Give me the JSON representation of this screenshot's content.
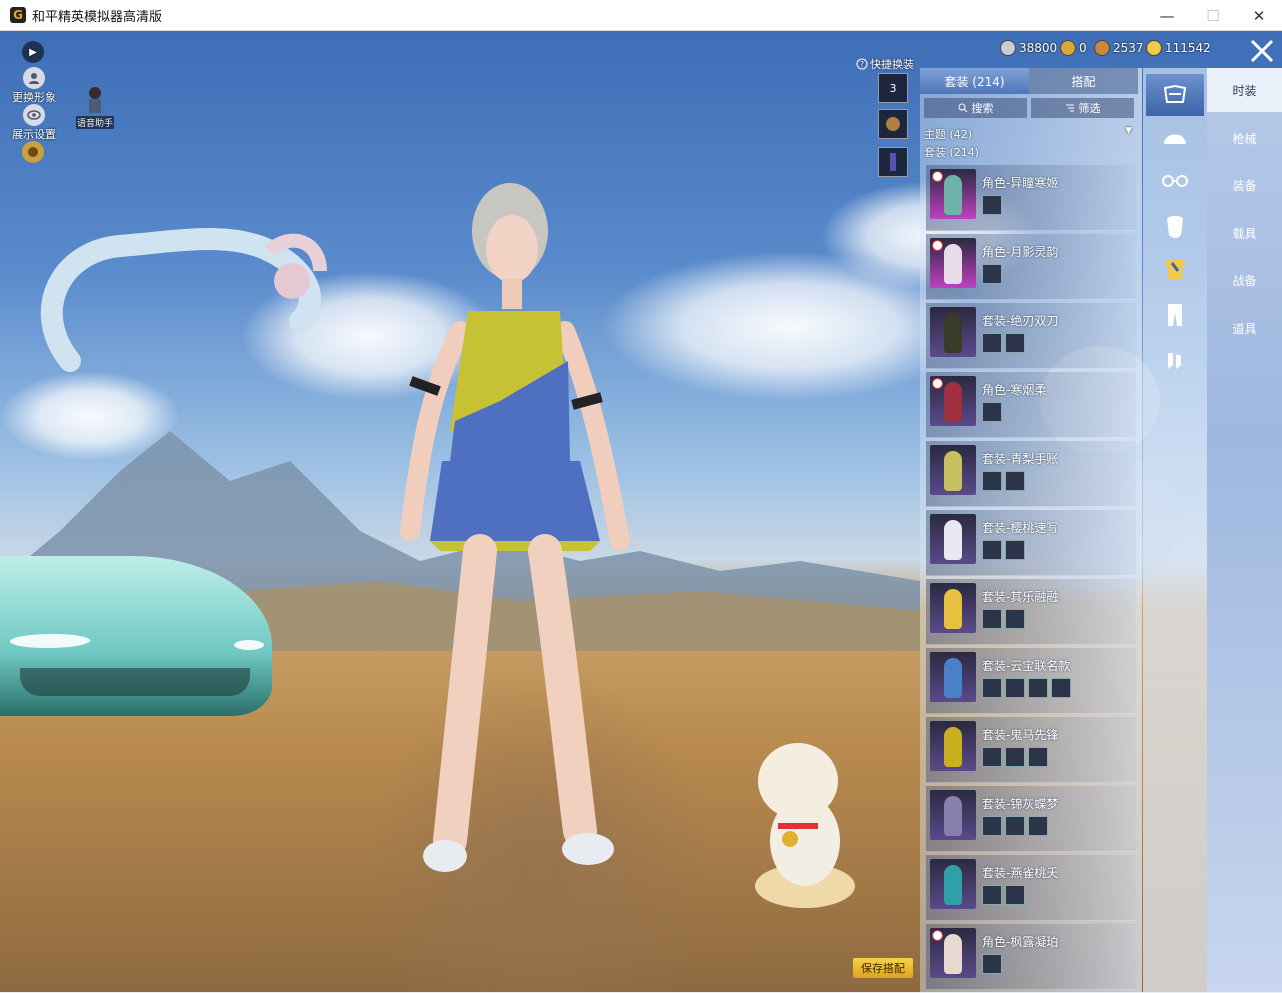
{
  "window": {
    "title": "和平精英模拟器高清版",
    "minimize": "—",
    "maximize": "☐",
    "close": "✕"
  },
  "left_tools": {
    "toggle_icon": "▶",
    "change_avatar": "更换形象",
    "display_settings": "展示设置",
    "assistant": "语音助手"
  },
  "currency": [
    {
      "name": "silver",
      "value": "38800",
      "color": "#c8ccd4"
    },
    {
      "name": "medal",
      "value": "0",
      "color": "#d9a63a"
    },
    {
      "name": "bronze",
      "value": "2537",
      "color": "#c88a3a"
    },
    {
      "name": "gold",
      "value": "111542",
      "color": "#f2c94c"
    }
  ],
  "quick_swap": {
    "label": "快捷换装",
    "slot_number": "3"
  },
  "panel": {
    "tabs": [
      {
        "label": "套装 (214)",
        "active": true
      },
      {
        "label": "搭配",
        "active": false
      }
    ],
    "search": "搜索",
    "filter": "筛选",
    "theme_category": "主题 (42)",
    "set_category": "套装 (214)"
  },
  "items": [
    {
      "name": "角色-异瞳寒姬",
      "role": true,
      "minis": 1,
      "thumb": "#c040c0",
      "fig": "#6fb3a8"
    },
    {
      "name": "角色-月影灵韵",
      "role": true,
      "minis": 1,
      "thumb": "#c040c0",
      "fig": "#e8dce8"
    },
    {
      "name": "套装-绝刃双刀",
      "role": false,
      "minis": 2,
      "thumb": "#5a4a8a",
      "fig": "#3a3a2a"
    },
    {
      "name": "角色-寒烟柔",
      "role": true,
      "minis": 1,
      "thumb": "#5a4a8a",
      "fig": "#a03040"
    },
    {
      "name": "套装-青梨手账",
      "role": false,
      "minis": 2,
      "thumb": "#5a4a8a",
      "fig": "#c8c060"
    },
    {
      "name": "套装-樱桃速写",
      "role": false,
      "minis": 2,
      "thumb": "#5a4a8a",
      "fig": "#e8e8f0"
    },
    {
      "name": "套装-其乐融融",
      "role": false,
      "minis": 2,
      "thumb": "#5a4a8a",
      "fig": "#e8c040"
    },
    {
      "name": "套装-云宝联名款",
      "role": false,
      "minis": 4,
      "thumb": "#5a4a8a",
      "fig": "#4a80c8"
    },
    {
      "name": "套装-鬼马先锋",
      "role": false,
      "minis": 3,
      "thumb": "#5a4a8a",
      "fig": "#c8b020"
    },
    {
      "name": "套装-锦灰蝶梦",
      "role": false,
      "minis": 3,
      "thumb": "#5a4a8a",
      "fig": "#8a80b0"
    },
    {
      "name": "套装-燕雀桃夭",
      "role": false,
      "minis": 2,
      "thumb": "#5a4a8a",
      "fig": "#30a0a8"
    },
    {
      "name": "角色-枫露凝珀",
      "role": true,
      "minis": 1,
      "thumb": "#5a4a8a",
      "fig": "#e8d8d0"
    }
  ],
  "category_icons": [
    "outfit-icon",
    "hat-icon",
    "glasses-icon",
    "mask-icon",
    "top-icon",
    "pants-icon",
    "shoes-icon"
  ],
  "nav": [
    "时装",
    "枪械",
    "装备",
    "载具",
    "战备",
    "道具"
  ],
  "save_button": "保存搭配",
  "colors": {
    "accent": "#4f76b8",
    "gold_button": "#f7d24c"
  }
}
